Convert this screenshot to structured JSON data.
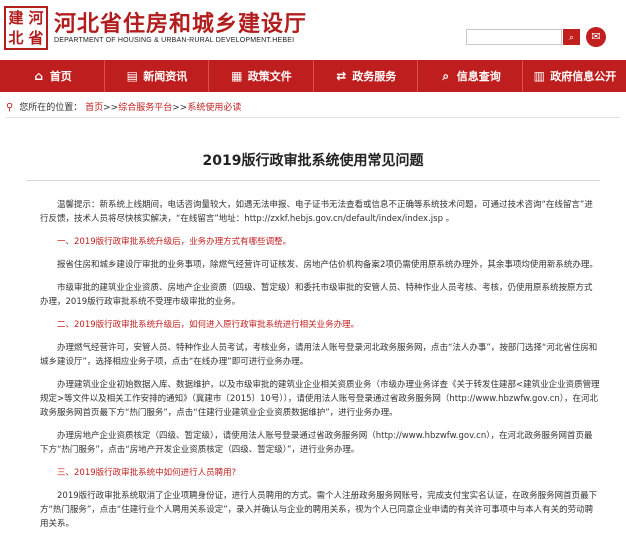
{
  "header": {
    "logo_chars": [
      "建",
      "河",
      "北",
      "省"
    ],
    "title": "河北省住房和城乡建设厅",
    "subtitle": "DEPARTMENT OF HOUSING & URBAN-RURAL DEVELOPMENT.HEBEI",
    "search_value": "",
    "search_button": "⌕",
    "mail_icon": "✉"
  },
  "nav": {
    "items": [
      {
        "icon": "⌂",
        "label": "首页"
      },
      {
        "icon": "▤",
        "label": "新闻资讯"
      },
      {
        "icon": "▦",
        "label": "政策文件"
      },
      {
        "icon": "⇄",
        "label": "政务服务"
      },
      {
        "icon": "⌕",
        "label": "信息查询"
      },
      {
        "icon": "▥",
        "label": "政府信息公开"
      }
    ]
  },
  "breadcrumb": {
    "prefix": "您所在的位置：",
    "items": [
      "首页",
      "综合服务平台",
      "系统使用必读"
    ],
    "separator": ">>"
  },
  "article": {
    "title": "2019版行政审批系统使用常见问题",
    "paragraphs": [
      {
        "style": "normal",
        "text": "温馨提示：新系统上线期间，电话咨询量较大，如遇无法申报、电子证书无法查看或信息不正确等系统技术问题，可通过技术咨询“在线留言”进行反馈，技术人员将尽快核实解决，“在线留言”地址：http://zxkf.hebjs.gov.cn/default/index/index.jsp 。"
      },
      {
        "style": "red",
        "text": "一、2019版行政审批系统升级后，业务办理方式有哪些调整。"
      },
      {
        "style": "normal",
        "text": "报省住房和城乡建设厅审批的业务事项，除燃气经营许可证核发、房地产估价机构备案2项仍需使用原系统办理外，其余事项均使用新系统办理。"
      },
      {
        "style": "normal",
        "text": "市级审批的建筑业企业资质、房地产企业资质（四级、暂定级）和委托市级审批的安管人员、特种作业人员考核、考核，仍使用原系统按原方式办理，2019版行政审批系统不受理市级审批的业务。"
      },
      {
        "style": "red",
        "text": "二、2019版行政审批系统升级后，如何进入原行政审批系统进行相关业务办理。"
      },
      {
        "style": "normal",
        "text": "办理燃气经营许可，安管人员、特种作业人员考试，考核业务，请用法人账号登录河北政务服务网，点击“法人办事”，按部门选择“河北省住房和城乡建设厅”，选择相应业务子项，点击“在线办理”即可进行业务办理。"
      },
      {
        "style": "normal",
        "text": "办理建筑业企业初始数据入库、数据维护，以及市级审批的建筑业企业相关资质业务（市级办理业务详查《关于转发住建部<建筑业企业资质管理规定>等文件以及相关工作安排的通知》（冀建市〔2015〕10号）），请使用法人账号登录通过省政务服务网（http://www.hbzwfw.gov.cn），在河北政务服务网首页最下方“热门服务”，点击“住建行业建筑业企业资质数据维护”，进行业务办理。"
      },
      {
        "style": "normal",
        "text": "办理房地产企业资质核定（四级、暂定级），请使用法人账号登录通过省政务服务网（http://www.hbzwfw.gov.cn），在河北政务服务网首页最下方“热门服务”，点击“房地产开发企业资质核定（四级、暂定级）”，进行业务办理。"
      },
      {
        "style": "red",
        "text": "三、2019版行政审批系统中如何进行人员聘用?"
      },
      {
        "style": "normal",
        "text": "2019版行政审批系统取消了企业项聘身份证，进行人员聘用的方式。需个人注册政务服务网账号，完成支付宝实名认证，在政务服务网首页最下方“热门服务”，点击“住建行业个人聘用关系设定”，录入并确认与企业的聘用关系，视为个人已同意企业申请的有关许可事项中与本人有关的劳动聘用关系。"
      }
    ]
  },
  "colors": {
    "brand_red": "#bf1e1e",
    "link_red": "#c21f1f",
    "text": "#333333"
  }
}
